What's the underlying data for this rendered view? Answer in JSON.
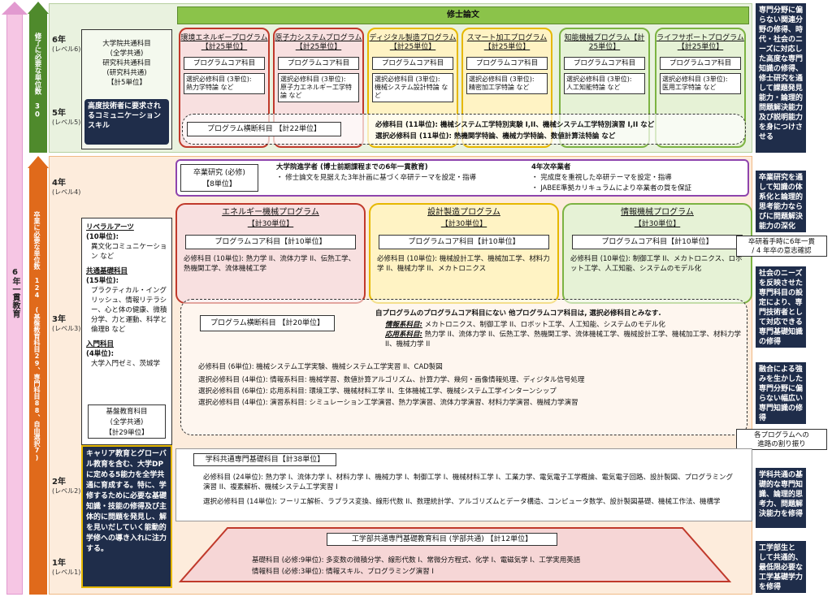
{
  "left": {
    "pink_label": "6年一貫教育",
    "green_label": "修了に必要な単位数 30",
    "orange_label": "卒業に必要な単位数 124 (基盤教育科目29、専門科目88、自由選択7)"
  },
  "years": [
    {
      "year": "6年",
      "level": "(レベル6)"
    },
    {
      "year": "5年",
      "level": "(レベル5)"
    },
    {
      "year": "4年",
      "level": "(レベル4)"
    },
    {
      "year": "3年",
      "level": "(レベル3)"
    },
    {
      "year": "2年",
      "level": "(レベル2)"
    },
    {
      "year": "1年",
      "level": "(レベル1)"
    }
  ],
  "grad_common": {
    "title": "大学院共通科目\n(全学共通)\n研究科共通科目\n(研究科共通)\n【計5単位】",
    "skill": "高度技術者に要求されるコミュニケーションスキル"
  },
  "thesis": "修士論文",
  "programs": [
    {
      "name": "環境エネルギープログラム【計25単位】",
      "core": "プログラムコア科目",
      "sel": "選択必修科目 (3単位):\n熱力学特論 など"
    },
    {
      "name": "原子力システムプログラム【計25単位】",
      "core": "プログラムコア科目",
      "sel": "選択必修科目 (3単位):\n原子力エネルギー工学特論 など"
    },
    {
      "name": "ディジタル製造プログラム【計25単位】",
      "core": "プログラムコア科目",
      "sel": "選択必修科目 (3単位):\n機械システム設計特論 など"
    },
    {
      "name": "スマート加工プログラム【計25単位】",
      "core": "プログラムコア科目",
      "sel": "選択必修科目 (3単位):\n精密加工学特論 など"
    },
    {
      "name": "知能機械プログラム【計25単位】",
      "core": "プログラムコア科目",
      "sel": "選択必修科目 (3単位):\n人工知能特論 など"
    },
    {
      "name": "ライフサポートプログラム【計25単位】",
      "core": "プログラムコア科目",
      "sel": "選択必修科目 (3単位):\n医用工学特論 など"
    }
  ],
  "cross5": {
    "title": "プログラム横断科目 【計22単位】",
    "req": "必修科目 (11単位):  機械システム工学特別実験 I,II、機械システム工学特別演習 I,II など",
    "sel": "選択必修科目 (11単位):  熱機関学特論、機械力学特論、数値計算法特論 など"
  },
  "year4": {
    "research_title": "卒業研究 (必修)\n【8単位】",
    "head1": "大学院進学者 (博士前期課程までの6年一貫教育)",
    "item1": "・ 修士論文を見据えた3年計画に基づく卒研テーマを設定・指導",
    "head2": "4年次卒業者",
    "item2a": "・ 完成度を重視した卒研テーマを設定・指導",
    "item2b": "・ JABEE準拠カリキュラムにより卒業者の質を保証"
  },
  "liberal": {
    "la_title": "リベラルアーツ",
    "la_units": "(10単位):",
    "la_items": "異文化コミュニケーション など",
    "common_title": "共通基礎科目",
    "common_units": "(15単位):",
    "common_items": "プラクティカル・イングリッシュ、情報リテラシー、心と体の健康、微積分学、力と運動、科学と倫理B など",
    "intro_title": "入門科目",
    "intro_units": "(4単位):",
    "intro_items": "大学入門ゼミ、茨城学",
    "base": "基盤教育科目\n(全学共通)\n【計29単位】",
    "career": "キャリア教育とグローバル教育を含む、大学DPに定める5能力を全学共通に育成する。特に、学修するために必要な基礎知識・技能の修得及び主体的に問題を発見し、解を見いだしていく能動的学修への導き入れに注力する。"
  },
  "l3programs": [
    {
      "name": "エネルギー機械プログラム",
      "units": "【計30単位】",
      "core": "プログラムコア科目【計10単位】",
      "req": "必修科目 (10単位):  熱力学 II、流体力学 II、伝熱工学、熱機関工学、流体機械工学"
    },
    {
      "name": "設計製造プログラム",
      "units": "【計30単位】",
      "core": "プログラムコア科目【計10単位】",
      "req": "必修科目 (10単位):  機械設計工学、機械加工学、材料力学 II、機械力学 II、メカトロニクス"
    },
    {
      "name": "情報機械プログラム",
      "units": "【計30単位】",
      "core": "プログラムコア科目【計10単位】",
      "req": "必修科目 (10単位):  制御工学 II、メカトロニクス、ロボット工学、人工知能、システムのモデル化"
    }
  ],
  "cross3": {
    "title": "プログラム横断科目 【計20単位】",
    "note": "自プログラムのプログラムコア科目にない 他プログラムコア科目は, 選択必修科目とみなす.",
    "info_label": "情報系科目:",
    "info": "メカトロニクス、制御工学 II、ロボット工学、人工知能、システムのモデル化",
    "app_label": "応用系科目:",
    "app": "熱力学 II、流体力学 II、伝熱工学、熱機関工学、流体機械工学、機械設計工学、機械加工学、材料力学 II、機械力学 II",
    "req": "必修科目 (6単位):  機械システム工学実験、機械システム工学実習 II、CAD製図",
    "s1": "選択必修科目 (4単位): 情報系科目:  機械学習、数値計算アルゴリズム、計算力学、幾何・画像情報処理、ディジタル信号処理",
    "s2": "選択必修科目 (6単位): 応用系科目:  環境工学、機械材料工学 II、生体機械工学、機械システム工学インターンシップ",
    "s3": "選択必修科目 (4単位): 演習系科目:  シミュレーション工学演習、熱力学演習、流体力学演習、材料力学演習、機械力学演習"
  },
  "year2": {
    "title": "学科共通専門基礎科目【計38単位】",
    "req": "必修科目 (24単位):  熱力学 I、流体力学 I、材料力学 I、機械力学 I、制御工学 I、機械材料工学 I、工業力学、電気電子工学概論、電気電子回路、設計製図、プログラミング演習 II、複素解析、機械システム工学実習 I",
    "sel": "選択必修科目 (14単位):  フーリエ解析、ラプラス変換、線形代数 II、数理統計学、アルゴリズムとデータ構造、コンピュータ数学、設計製図基礎、機械工作法、機構学"
  },
  "year1": {
    "title": "工学部共通専門基礎教育科目 (学部共通) 【計12単位】",
    "base": "基礎科目 (必修:9単位):  多変数の微積分学、線形代数 I、常微分方程式、化学 I、電磁気学 I、工学実用英語",
    "info": "情報科目 (必修:3単位):  情報スキル、プログラミング演習 I"
  },
  "callouts": {
    "c1": "卒研着手時に6年一貫\n/ 4 年卒の意志確認",
    "c2": "各プログラムへの\n進路の割り振り"
  },
  "right": [
    "専門分野に偏らない関連分野の修得、時代・社会のニーズに対応した高度な専門知識の修得、修士研究を通して課題発見能力・論理的問題解決能力及び説明能力を身につけさせる",
    "卒業研究を通して知識の体系化と論理的思考能力ならびに問題解決能力の深化",
    "社会のニーズを反映させた専門科目の設定により、専門技術者として対応できる専門基礎知識の修得",
    "融合による強みを生かした専門分野に偏らない幅広い専門知識の修得",
    "学科共通の基礎的な専門知識、論理的思考力、問題解決能力を修得",
    "工学部生として共通的、最低限必要な工学基礎学力を修得"
  ],
  "colors": {
    "red": "#c0392b",
    "redbg": "#f6d6d6",
    "yellow": "#e6b800",
    "yellowbg": "#fff3c4",
    "green": "#7cb342",
    "greenbg": "#e6f2d6"
  }
}
